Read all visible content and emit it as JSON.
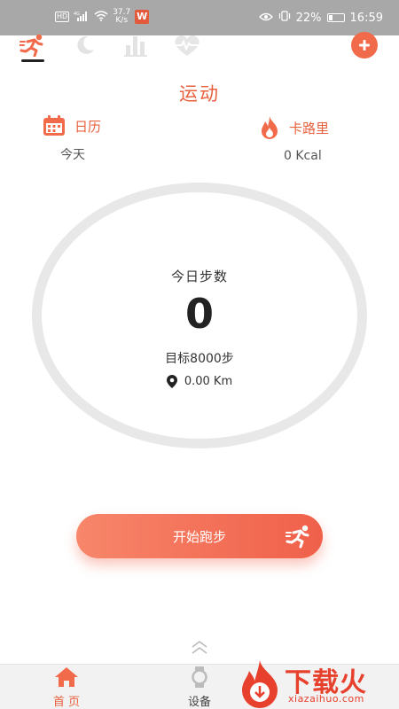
{
  "status": {
    "net_speed_top": "37.7",
    "net_speed_bottom": "K/s",
    "signal_label": "4G",
    "hd_label": "HD",
    "w_label": "W",
    "battery": "22%",
    "time": "16:59"
  },
  "tabs": [
    {
      "icon": "running-icon",
      "active": true
    },
    {
      "icon": "moon-icon",
      "active": false
    },
    {
      "icon": "bar-chart-icon",
      "active": false
    },
    {
      "icon": "heart-rate-icon",
      "active": false
    }
  ],
  "page": {
    "title": "运动"
  },
  "calendar": {
    "label": "日历",
    "value": "今天"
  },
  "calories": {
    "label": "卡路里",
    "value": "0 Kcal"
  },
  "steps": {
    "label": "今日步数",
    "count": "0",
    "goal": "目标8000步",
    "distance": "0.00 Km"
  },
  "run_button": {
    "label": "开始跑步"
  },
  "nav": {
    "home": "首 页",
    "device": "设备"
  },
  "watermark": {
    "text": "下载火",
    "url": "xiazaihuo.com"
  },
  "colors": {
    "accent": "#e8613f",
    "ring": "#e8e8e8",
    "statusbar": "#a8a8a8"
  }
}
